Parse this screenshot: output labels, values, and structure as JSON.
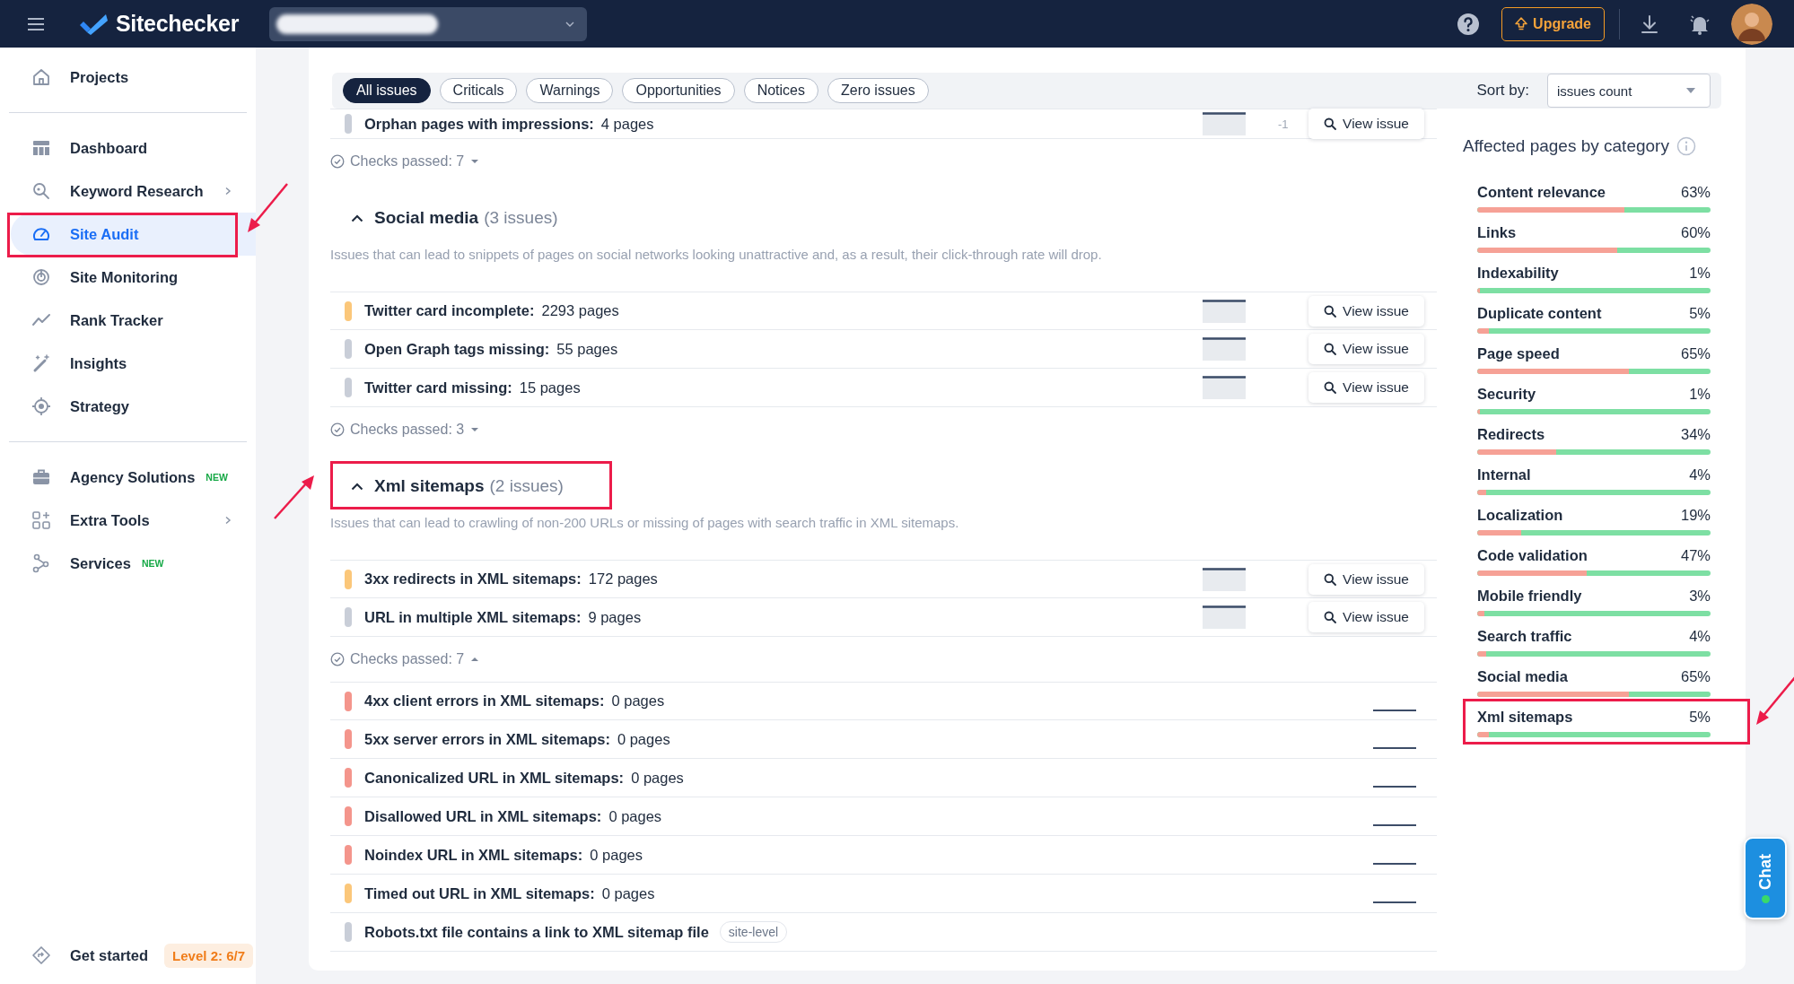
{
  "header": {
    "logo": "Sitechecker",
    "upgrade": "Upgrade"
  },
  "sidebar": {
    "groups": [
      [
        {
          "label": "Projects",
          "selected": false,
          "highlighted": false,
          "has_submenu": false
        }
      ],
      [
        {
          "label": "Dashboard",
          "selected": false,
          "highlighted": false,
          "has_submenu": false
        },
        {
          "label": "Keyword Research",
          "selected": false,
          "highlighted": false,
          "has_submenu": true
        },
        {
          "label": "Site Audit",
          "selected": true,
          "highlighted": true,
          "has_submenu": false
        },
        {
          "label": "Site Monitoring",
          "selected": false,
          "highlighted": false,
          "has_submenu": false
        },
        {
          "label": "Rank Tracker",
          "selected": false,
          "highlighted": false,
          "has_submenu": false
        },
        {
          "label": "Insights",
          "selected": false,
          "highlighted": false,
          "has_submenu": false
        },
        {
          "label": "Strategy",
          "selected": false,
          "highlighted": false,
          "has_submenu": false
        }
      ],
      [
        {
          "label": "Agency Solutions",
          "selected": false,
          "highlighted": false,
          "has_submenu": false,
          "badge": "NEW"
        },
        {
          "label": "Extra Tools",
          "selected": false,
          "highlighted": false,
          "has_submenu": true
        },
        {
          "label": "Services",
          "selected": false,
          "highlighted": false,
          "has_submenu": false,
          "badge": "NEW"
        }
      ]
    ],
    "footer": {
      "label": "Get started",
      "badge": "Level 2: 6/7"
    }
  },
  "filters": [
    {
      "label": "All issues",
      "selected": true
    },
    {
      "label": "Criticals",
      "selected": false
    },
    {
      "label": "Warnings",
      "selected": false
    },
    {
      "label": "Opportunities",
      "selected": false
    },
    {
      "label": "Notices",
      "selected": false
    },
    {
      "label": "Zero issues",
      "selected": false
    }
  ],
  "sort": {
    "label": "Sort by:",
    "value": "issues count"
  },
  "sections": [
    {
      "rows": [
        {
          "color": "#c9ced8",
          "name": "Orphan pages with impressions:",
          "count": "4 pages",
          "delta": "-1",
          "action": "View issue"
        }
      ],
      "checks_passed": {
        "label": "Checks passed: 7",
        "expanded": false
      }
    },
    {
      "title": "Social media",
      "issues": "(3 issues)",
      "expanded": true,
      "highlighted": false,
      "description": "Issues that can lead to snippets of pages on social networks looking unattractive and, as a result, their click-through rate will drop.",
      "rows": [
        {
          "color": "#fbc77a",
          "name": "Twitter card incomplete:",
          "count": "2293 pages",
          "action": "View issue"
        },
        {
          "color": "#c9ced8",
          "name": "Open Graph tags missing:",
          "count": "55 pages",
          "action": "View issue"
        },
        {
          "color": "#c9ced8",
          "name": "Twitter card missing:",
          "count": "15 pages",
          "action": "View issue"
        }
      ],
      "checks_passed": {
        "label": "Checks passed: 3",
        "expanded": false
      }
    },
    {
      "title": "Xml sitemaps",
      "issues": "(2 issues)",
      "expanded": true,
      "highlighted": true,
      "description": "Issues that can lead to crawling of non-200 URLs or missing of pages with search traffic in XML sitemaps.",
      "rows": [
        {
          "color": "#fbc77a",
          "name": "3xx redirects in XML sitemaps:",
          "count": "172 pages",
          "action": "View issue"
        },
        {
          "color": "#c9ced8",
          "name": "URL in multiple XML sitemaps:",
          "count": "9 pages",
          "action": "View issue"
        }
      ],
      "checks_passed": {
        "label": "Checks passed: 7",
        "expanded": true
      },
      "passed_rows": [
        {
          "color": "#f4958c",
          "name": "4xx client errors in XML sitemaps:",
          "count": "0 pages"
        },
        {
          "color": "#f4958c",
          "name": "5xx server errors in XML sitemaps:",
          "count": "0 pages"
        },
        {
          "color": "#f4958c",
          "name": "Canonicalized URL in XML sitemaps:",
          "count": "0 pages"
        },
        {
          "color": "#f4958c",
          "name": "Disallowed URL in XML sitemaps:",
          "count": "0 pages"
        },
        {
          "color": "#f4958c",
          "name": "Noindex URL in XML sitemaps:",
          "count": "0 pages"
        },
        {
          "color": "#fbc77a",
          "name": "Timed out URL in XML sitemaps:",
          "count": "0 pages"
        },
        {
          "color": "#c9ced8",
          "name": "Robots.txt file contains a link to XML sitemap file",
          "tag": "site-level"
        }
      ]
    }
  ],
  "categories": {
    "title": "Affected pages by category",
    "items": [
      {
        "name": "Content relevance",
        "percent": "63%",
        "level": 0.63,
        "highlighted": false
      },
      {
        "name": "Links",
        "percent": "60%",
        "level": 0.6,
        "highlighted": false
      },
      {
        "name": "Indexability",
        "percent": "1%",
        "level": 0.01,
        "highlighted": false
      },
      {
        "name": "Duplicate content",
        "percent": "5%",
        "level": 0.05,
        "highlighted": false
      },
      {
        "name": "Page speed",
        "percent": "65%",
        "level": 0.65,
        "highlighted": false
      },
      {
        "name": "Security",
        "percent": "1%",
        "level": 0.01,
        "highlighted": false
      },
      {
        "name": "Redirects",
        "percent": "34%",
        "level": 0.34,
        "highlighted": false
      },
      {
        "name": "Internal",
        "percent": "4%",
        "level": 0.04,
        "highlighted": false
      },
      {
        "name": "Localization",
        "percent": "19%",
        "level": 0.19,
        "highlighted": false
      },
      {
        "name": "Code validation",
        "percent": "47%",
        "level": 0.47,
        "highlighted": false
      },
      {
        "name": "Mobile friendly",
        "percent": "3%",
        "level": 0.03,
        "highlighted": false
      },
      {
        "name": "Search traffic",
        "percent": "4%",
        "level": 0.04,
        "highlighted": false
      },
      {
        "name": "Social media",
        "percent": "65%",
        "level": 0.65,
        "highlighted": false
      },
      {
        "name": "Xml sitemaps",
        "percent": "5%",
        "level": 0.05,
        "highlighted": true
      }
    ]
  },
  "chat": {
    "label": "Chat"
  }
}
